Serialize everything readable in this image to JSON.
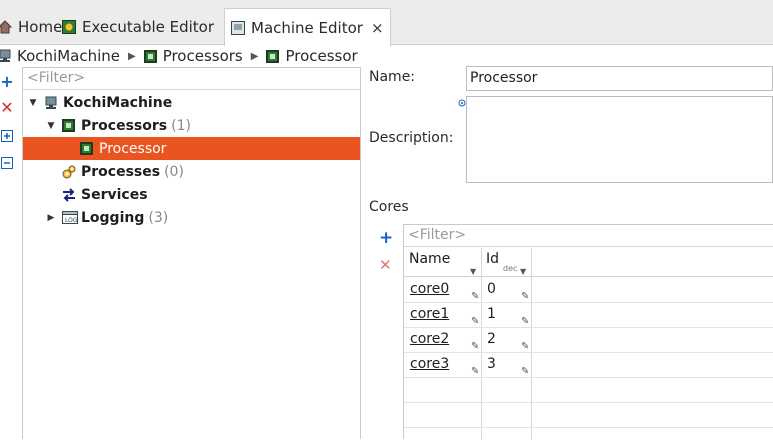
{
  "tabs": [
    {
      "label": "Home",
      "icon": "home-icon"
    },
    {
      "label": "Executable Editor",
      "icon": "executable-editor-icon"
    },
    {
      "label": "Machine Editor",
      "icon": "machine-editor-icon",
      "close": "×"
    }
  ],
  "breadcrumb": [
    "KochiMachine",
    "Processors",
    "Processor"
  ],
  "tree": {
    "filter_placeholder": "<Filter>",
    "root": "KochiMachine",
    "processors": {
      "label": "Processors",
      "count": "(1)"
    },
    "processor": "Processor",
    "processes": {
      "label": "Processes",
      "count": "(0)"
    },
    "services": "Services",
    "logging": {
      "label": "Logging",
      "count": "(3)"
    }
  },
  "form": {
    "name_label": "Name:",
    "name_value": "Processor",
    "description_label": "Description:",
    "description_value": "",
    "cores_label": "Cores"
  },
  "cores": {
    "filter_placeholder": "<Filter>",
    "columns": {
      "name": "Name",
      "id": "Id",
      "id_sub": "dec"
    },
    "rows": [
      {
        "name": "core0",
        "id": "0"
      },
      {
        "name": "core1",
        "id": "1"
      },
      {
        "name": "core2",
        "id": "2"
      },
      {
        "name": "core3",
        "id": "3"
      }
    ]
  },
  "colors": {
    "selection": "#e95420",
    "chip": "#2e7d32",
    "add": "#1565c0",
    "delete": "#d32f2f"
  }
}
